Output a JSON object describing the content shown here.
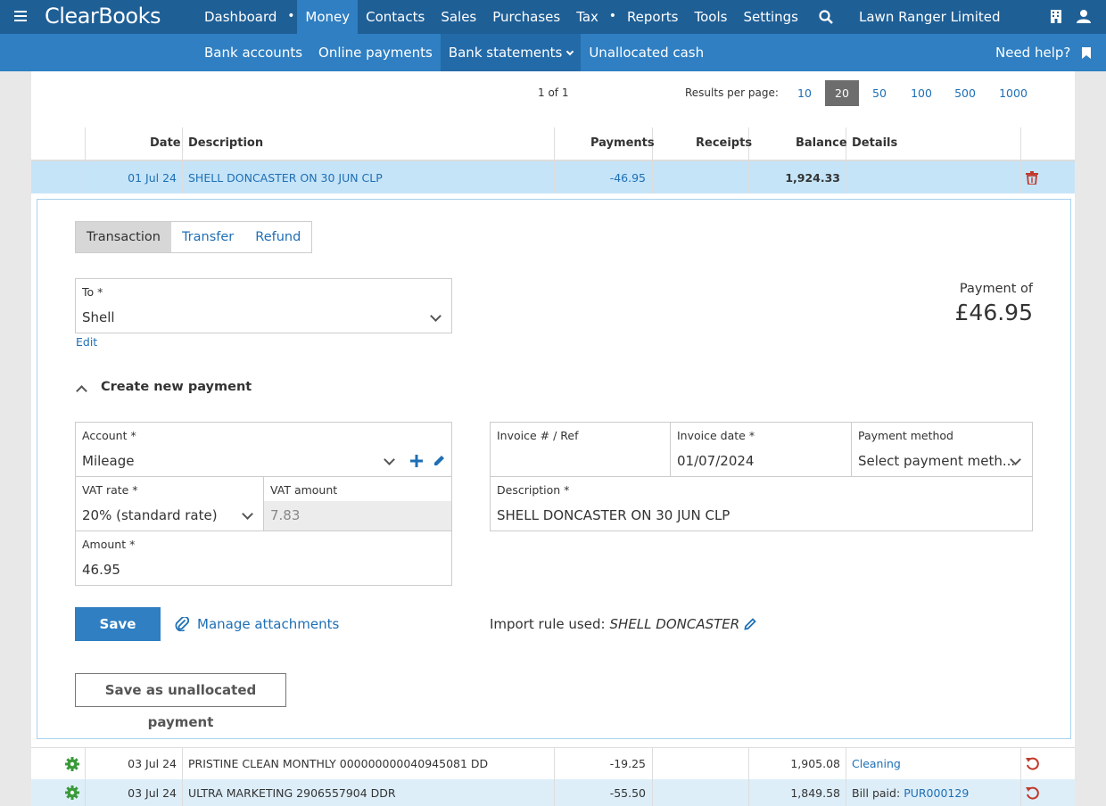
{
  "topbar": {
    "logo": "ClearBooks",
    "nav": [
      "Dashboard",
      "Money",
      "Contacts",
      "Sales",
      "Purchases",
      "Tax",
      "Reports",
      "Tools",
      "Settings"
    ],
    "company": "Lawn Ranger Limited"
  },
  "subbar": {
    "nav": [
      "Bank accounts",
      "Online payments",
      "Bank statements",
      "Unallocated cash"
    ],
    "help": "Need help?"
  },
  "pager": {
    "page": "1 of 1",
    "rpp_label": "Results per page:",
    "options": [
      "10",
      "20",
      "50",
      "100",
      "500",
      "1000"
    ],
    "selected": "20"
  },
  "table": {
    "headers": {
      "date": "Date",
      "description": "Description",
      "payments": "Payments",
      "receipts": "Receipts",
      "balance": "Balance",
      "details": "Details"
    },
    "rows": [
      {
        "date": "01 Jul 24",
        "description": "SHELL DONCASTER ON 30 JUN CLP",
        "payments": "-46.95",
        "receipts": "",
        "balance": "1,924.33",
        "details": ""
      },
      {
        "date": "03 Jul 24",
        "description": "PRISTINE CLEAN MONTHLY 000000000040945081 DD",
        "payments": "-19.25",
        "receipts": "",
        "balance": "1,905.08",
        "details": "Cleaning",
        "details_prefix": ""
      },
      {
        "date": "03 Jul 24",
        "description": "ULTRA MARKETING 2906557904 DDR",
        "payments": "-55.50",
        "receipts": "",
        "balance": "1,849.58",
        "details_prefix": "Bill paid:",
        "details": "PUR000129"
      }
    ]
  },
  "editor": {
    "tabs": [
      "Transaction",
      "Transfer",
      "Refund"
    ],
    "to_label": "To *",
    "to_value": "Shell",
    "edit_link": "Edit",
    "payment_of_label": "Payment of",
    "payment_amount": "£46.95",
    "section_title": "Create new payment",
    "account_label": "Account *",
    "account_value": "Mileage",
    "vat_rate_label": "VAT rate *",
    "vat_rate_value": "20% (standard rate)",
    "vat_amount_label": "VAT amount",
    "vat_amount_value": "7.83",
    "amount_label": "Amount *",
    "amount_value": "46.95",
    "invoice_ref_label": "Invoice # / Ref",
    "invoice_ref_value": "",
    "invoice_date_label": "Invoice date *",
    "invoice_date_value": "01/07/2024",
    "payment_method_label": "Payment method",
    "payment_method_value": "Select payment meth...",
    "description_label": "Description *",
    "description_value": "SHELL DONCASTER ON 30 JUN CLP",
    "save": "Save",
    "manage_attachments": "Manage attachments",
    "import_rule_label": "Import rule used:",
    "import_rule_value": "SHELL DONCASTER",
    "save_unallocated": "Save as unallocated payment"
  },
  "colors": {
    "primary": "#1e5f96",
    "secondary": "#2f7fc2",
    "link": "#1e6fb5",
    "danger": "#c0392b",
    "success": "#3a9a3a"
  }
}
